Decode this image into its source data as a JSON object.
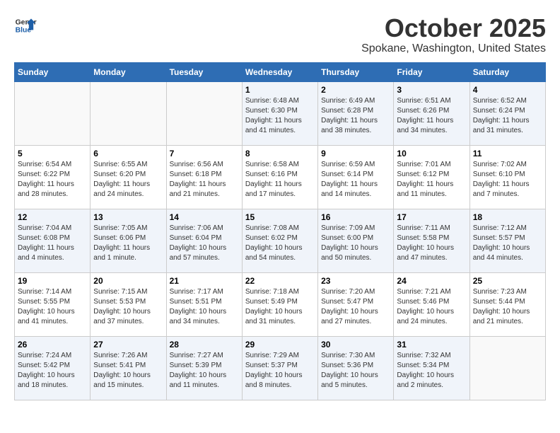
{
  "header": {
    "logo_line1": "General",
    "logo_line2": "Blue",
    "month": "October 2025",
    "location": "Spokane, Washington, United States"
  },
  "weekdays": [
    "Sunday",
    "Monday",
    "Tuesday",
    "Wednesday",
    "Thursday",
    "Friday",
    "Saturday"
  ],
  "weeks": [
    [
      {
        "day": "",
        "sunrise": "",
        "sunset": "",
        "daylight": ""
      },
      {
        "day": "",
        "sunrise": "",
        "sunset": "",
        "daylight": ""
      },
      {
        "day": "",
        "sunrise": "",
        "sunset": "",
        "daylight": ""
      },
      {
        "day": "1",
        "sunrise": "Sunrise: 6:48 AM",
        "sunset": "Sunset: 6:30 PM",
        "daylight": "Daylight: 11 hours and 41 minutes."
      },
      {
        "day": "2",
        "sunrise": "Sunrise: 6:49 AM",
        "sunset": "Sunset: 6:28 PM",
        "daylight": "Daylight: 11 hours and 38 minutes."
      },
      {
        "day": "3",
        "sunrise": "Sunrise: 6:51 AM",
        "sunset": "Sunset: 6:26 PM",
        "daylight": "Daylight: 11 hours and 34 minutes."
      },
      {
        "day": "4",
        "sunrise": "Sunrise: 6:52 AM",
        "sunset": "Sunset: 6:24 PM",
        "daylight": "Daylight: 11 hours and 31 minutes."
      }
    ],
    [
      {
        "day": "5",
        "sunrise": "Sunrise: 6:54 AM",
        "sunset": "Sunset: 6:22 PM",
        "daylight": "Daylight: 11 hours and 28 minutes."
      },
      {
        "day": "6",
        "sunrise": "Sunrise: 6:55 AM",
        "sunset": "Sunset: 6:20 PM",
        "daylight": "Daylight: 11 hours and 24 minutes."
      },
      {
        "day": "7",
        "sunrise": "Sunrise: 6:56 AM",
        "sunset": "Sunset: 6:18 PM",
        "daylight": "Daylight: 11 hours and 21 minutes."
      },
      {
        "day": "8",
        "sunrise": "Sunrise: 6:58 AM",
        "sunset": "Sunset: 6:16 PM",
        "daylight": "Daylight: 11 hours and 17 minutes."
      },
      {
        "day": "9",
        "sunrise": "Sunrise: 6:59 AM",
        "sunset": "Sunset: 6:14 PM",
        "daylight": "Daylight: 11 hours and 14 minutes."
      },
      {
        "day": "10",
        "sunrise": "Sunrise: 7:01 AM",
        "sunset": "Sunset: 6:12 PM",
        "daylight": "Daylight: 11 hours and 11 minutes."
      },
      {
        "day": "11",
        "sunrise": "Sunrise: 7:02 AM",
        "sunset": "Sunset: 6:10 PM",
        "daylight": "Daylight: 11 hours and 7 minutes."
      }
    ],
    [
      {
        "day": "12",
        "sunrise": "Sunrise: 7:04 AM",
        "sunset": "Sunset: 6:08 PM",
        "daylight": "Daylight: 11 hours and 4 minutes."
      },
      {
        "day": "13",
        "sunrise": "Sunrise: 7:05 AM",
        "sunset": "Sunset: 6:06 PM",
        "daylight": "Daylight: 11 hours and 1 minute."
      },
      {
        "day": "14",
        "sunrise": "Sunrise: 7:06 AM",
        "sunset": "Sunset: 6:04 PM",
        "daylight": "Daylight: 10 hours and 57 minutes."
      },
      {
        "day": "15",
        "sunrise": "Sunrise: 7:08 AM",
        "sunset": "Sunset: 6:02 PM",
        "daylight": "Daylight: 10 hours and 54 minutes."
      },
      {
        "day": "16",
        "sunrise": "Sunrise: 7:09 AM",
        "sunset": "Sunset: 6:00 PM",
        "daylight": "Daylight: 10 hours and 50 minutes."
      },
      {
        "day": "17",
        "sunrise": "Sunrise: 7:11 AM",
        "sunset": "Sunset: 5:58 PM",
        "daylight": "Daylight: 10 hours and 47 minutes."
      },
      {
        "day": "18",
        "sunrise": "Sunrise: 7:12 AM",
        "sunset": "Sunset: 5:57 PM",
        "daylight": "Daylight: 10 hours and 44 minutes."
      }
    ],
    [
      {
        "day": "19",
        "sunrise": "Sunrise: 7:14 AM",
        "sunset": "Sunset: 5:55 PM",
        "daylight": "Daylight: 10 hours and 41 minutes."
      },
      {
        "day": "20",
        "sunrise": "Sunrise: 7:15 AM",
        "sunset": "Sunset: 5:53 PM",
        "daylight": "Daylight: 10 hours and 37 minutes."
      },
      {
        "day": "21",
        "sunrise": "Sunrise: 7:17 AM",
        "sunset": "Sunset: 5:51 PM",
        "daylight": "Daylight: 10 hours and 34 minutes."
      },
      {
        "day": "22",
        "sunrise": "Sunrise: 7:18 AM",
        "sunset": "Sunset: 5:49 PM",
        "daylight": "Daylight: 10 hours and 31 minutes."
      },
      {
        "day": "23",
        "sunrise": "Sunrise: 7:20 AM",
        "sunset": "Sunset: 5:47 PM",
        "daylight": "Daylight: 10 hours and 27 minutes."
      },
      {
        "day": "24",
        "sunrise": "Sunrise: 7:21 AM",
        "sunset": "Sunset: 5:46 PM",
        "daylight": "Daylight: 10 hours and 24 minutes."
      },
      {
        "day": "25",
        "sunrise": "Sunrise: 7:23 AM",
        "sunset": "Sunset: 5:44 PM",
        "daylight": "Daylight: 10 hours and 21 minutes."
      }
    ],
    [
      {
        "day": "26",
        "sunrise": "Sunrise: 7:24 AM",
        "sunset": "Sunset: 5:42 PM",
        "daylight": "Daylight: 10 hours and 18 minutes."
      },
      {
        "day": "27",
        "sunrise": "Sunrise: 7:26 AM",
        "sunset": "Sunset: 5:41 PM",
        "daylight": "Daylight: 10 hours and 15 minutes."
      },
      {
        "day": "28",
        "sunrise": "Sunrise: 7:27 AM",
        "sunset": "Sunset: 5:39 PM",
        "daylight": "Daylight: 10 hours and 11 minutes."
      },
      {
        "day": "29",
        "sunrise": "Sunrise: 7:29 AM",
        "sunset": "Sunset: 5:37 PM",
        "daylight": "Daylight: 10 hours and 8 minutes."
      },
      {
        "day": "30",
        "sunrise": "Sunrise: 7:30 AM",
        "sunset": "Sunset: 5:36 PM",
        "daylight": "Daylight: 10 hours and 5 minutes."
      },
      {
        "day": "31",
        "sunrise": "Sunrise: 7:32 AM",
        "sunset": "Sunset: 5:34 PM",
        "daylight": "Daylight: 10 hours and 2 minutes."
      },
      {
        "day": "",
        "sunrise": "",
        "sunset": "",
        "daylight": ""
      }
    ]
  ]
}
